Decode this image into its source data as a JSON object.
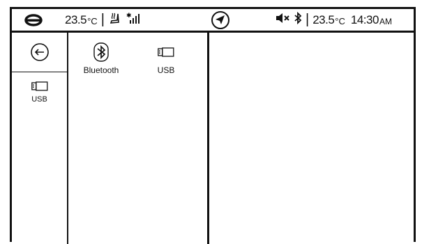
{
  "status_bar": {
    "logo_icon": "brand-logo-icon",
    "temp_left": "23.5",
    "temp_left_unit": "°C",
    "separator": "|",
    "seat_icon": "seat-heat-icon",
    "signal_icon": "signal-strength-icon",
    "nav_icon": "navigation-arrow-icon",
    "mute_icon": "mute-icon",
    "bluetooth_icon": "bluetooth-icon",
    "temp_right": "23.5",
    "temp_right_unit": "°C",
    "time": "14:30",
    "ampm": "AM"
  },
  "left_panel": {
    "back_icon": "back-arrow-icon",
    "items": [
      {
        "label": "USB",
        "icon": "usb-drive-icon"
      }
    ]
  },
  "source_tiles": [
    {
      "label": "Bluetooth",
      "icon": "bluetooth-icon"
    },
    {
      "label": "USB",
      "icon": "usb-drive-icon"
    }
  ]
}
